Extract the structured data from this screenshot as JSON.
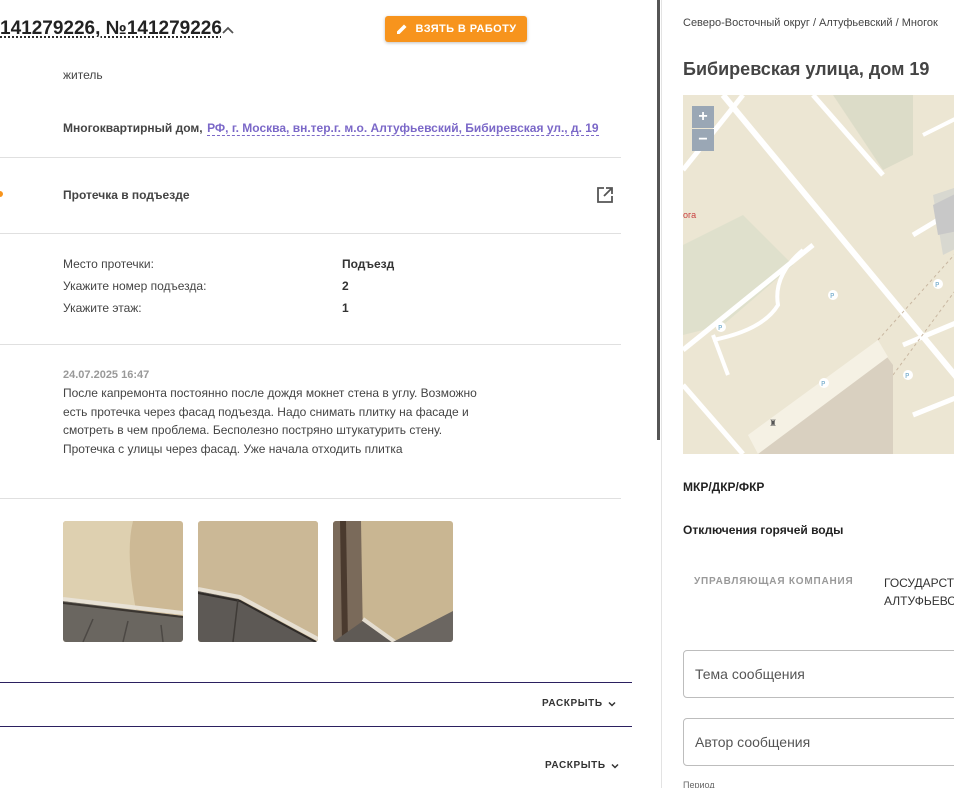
{
  "header": {
    "title": "141279226, №141279226",
    "take_button": "ВЗЯТЬ В РАБОТУ"
  },
  "applicant": {
    "role": "житель"
  },
  "address": {
    "type_label": "Многоквартирный дом,",
    "link": "РФ, г. Москва, вн.тер.г. м.о. Алтуфьевский, Бибиревская ул., д. 19"
  },
  "problem": {
    "title": "Протечка в подъезде"
  },
  "fields": [
    {
      "label": "Место протечки:",
      "value": "Подъезд"
    },
    {
      "label": "Укажите номер подъезда:",
      "value": "2"
    },
    {
      "label": "Укажите этаж:",
      "value": "1"
    }
  ],
  "comment": {
    "datetime": "24.07.2025 16:47",
    "text": "После капремонта постоянно после дождя мокнет стена в углу. Возможно есть протечка через фасад подъезда. Надо снимать плитку на фасаде и смотреть в чем проблема. Бесполезно постряно штукатурить стену. Протечка с улицы через фасад. Уже начала отходить плитка"
  },
  "sections": [
    {
      "expand_label": "РАСКРЫТЬ"
    },
    {
      "expand_label": "РАСКРЫТЬ"
    }
  ],
  "right_panel": {
    "breadcrumbs": "Северо-Восточный округ / Алтуфьевский / Многок",
    "object_title": "Бибиревская улица, дом 19",
    "map": {
      "zoom_in": "+",
      "zoom_out": "−",
      "label_fragment": "ога"
    },
    "programs_title": "МКР/ДКР/ФКР",
    "hot_water_title": "Отключения горячей воды",
    "management": {
      "label": "УПРАВЛЯЮЩАЯ КОМПАНИЯ",
      "value_line1": "ГОСУДАРСТ",
      "value_line2": "АЛТУФЬЕВС"
    },
    "subject_placeholder": "Тема сообщения",
    "author_placeholder": "Автор сообщения",
    "period_label": "Период"
  },
  "colors": {
    "accent_orange": "#f7941d",
    "link_purple": "#7b68c8",
    "dark_divider": "#2b2060"
  }
}
